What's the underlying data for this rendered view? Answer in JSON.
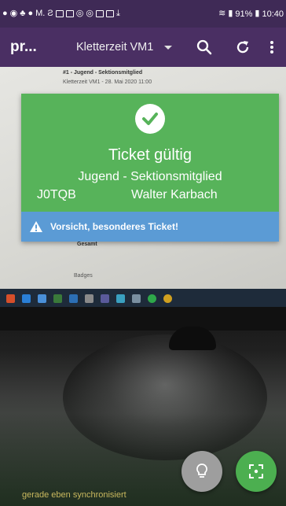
{
  "status_bar": {
    "battery": "91%",
    "time": "10:40",
    "carrier_label": "M."
  },
  "app_bar": {
    "title": "pr...",
    "event": "Kletterzeit VM1"
  },
  "background_screen": {
    "line1": "#1 - Jugend - Sektionsmitglied",
    "line2": "Kletterzeit VM1 - 28. Mai 2020 11:00",
    "line3": "Gesamt",
    "line4": "Badges"
  },
  "ticket": {
    "status": "Ticket gültig",
    "type": "Jugend - Sektionsmitglied",
    "code": "J0TQB",
    "name": "Walter Karbach",
    "warning": "Vorsicht, besonderes Ticket!",
    "valid_color": "#57b35a",
    "warning_color": "#5b9bd5"
  },
  "footer": {
    "sync_status": "gerade eben synchronisiert"
  },
  "icons": {
    "search": "search-icon",
    "refresh": "refresh-icon",
    "more": "more-vert-icon",
    "flashlight": "lightbulb-icon",
    "scan": "scan-icon"
  }
}
